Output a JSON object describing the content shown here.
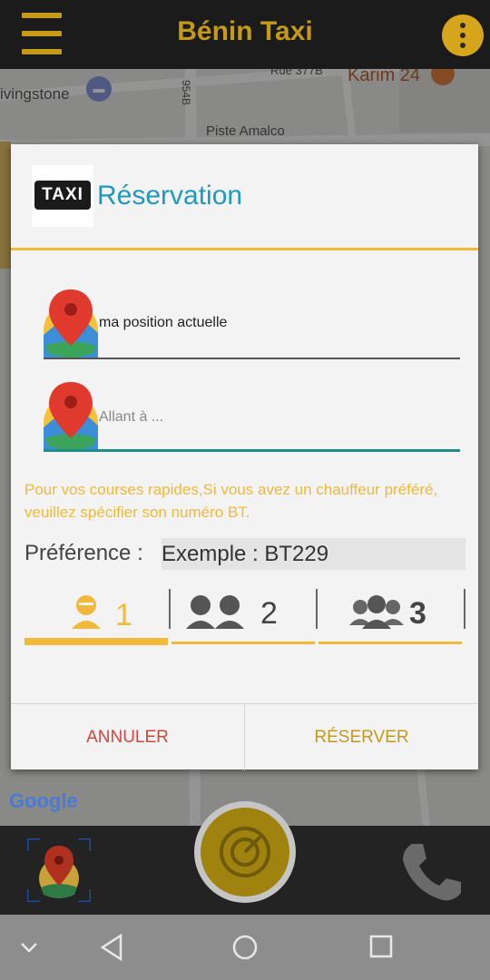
{
  "app": {
    "title": "Bénin Taxi"
  },
  "map": {
    "labels": [
      "ivingstone",
      "Rue 377B",
      "Karim 24",
      "Piste Amalco",
      "954B"
    ],
    "attribution": "Google"
  },
  "dialog": {
    "title": "Réservation",
    "logo_text": "TAXI",
    "origin": {
      "value": "ma position actuelle"
    },
    "destination": {
      "placeholder": "Allant à ..."
    },
    "info_text": "Pour vos courses rapides,Si vous avez un chauffeur préféré, veuillez spécifier son numéro BT.",
    "preference": {
      "label": "Préférence :",
      "placeholder": "Exemple : BT229"
    },
    "passenger_tabs": [
      {
        "label": "1",
        "selected": true
      },
      {
        "label": "2",
        "selected": false
      },
      {
        "label": "3",
        "selected": false
      }
    ],
    "cancel_label": "ANNULER",
    "confirm_label": "RÉSERVER"
  },
  "colors": {
    "accent": "#f0b93a",
    "title_blue": "#1e9ac0",
    "cancel_red": "#d0473a",
    "confirm_gold": "#c59a1a"
  },
  "icons": {
    "menu": "hamburger-icon",
    "more": "more-vertical-icon",
    "location": "map-pin-icon",
    "radar": "radar-icon",
    "phone": "phone-icon"
  }
}
